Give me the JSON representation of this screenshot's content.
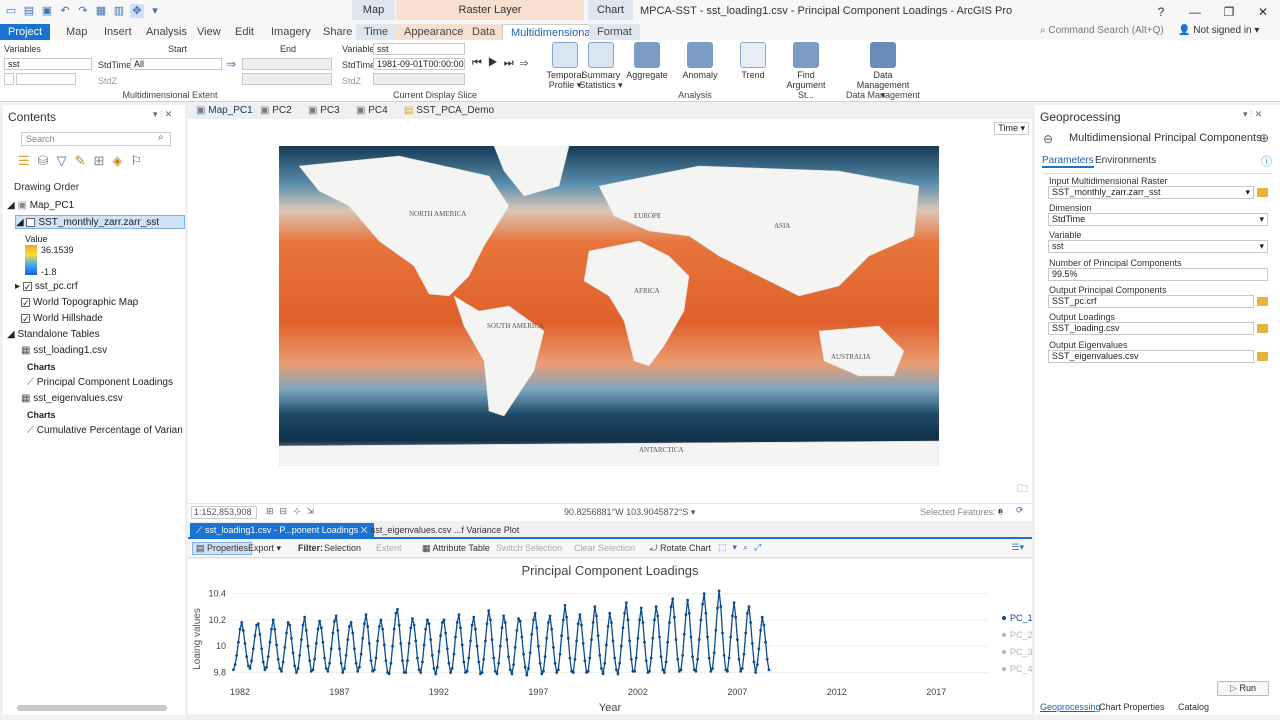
{
  "window": {
    "title": "MPCA-SST - sst_loading1.csv - Principal Component Loadings - ArcGIS Pro",
    "signed_in": "Not signed in",
    "command_search": "Command Search (Alt+Q)"
  },
  "context_headers": {
    "map": "Map",
    "raster_layer": "Raster Layer",
    "chart": "Chart"
  },
  "tabs": [
    "Project",
    "Map",
    "Insert",
    "Analysis",
    "View",
    "Edit",
    "Imagery",
    "Share",
    "Time",
    "Appearance",
    "Data",
    "Multidimensional",
    "Format"
  ],
  "ribbon": {
    "extent": {
      "variables_label": "Variables",
      "variables_value": "sst",
      "start_label": "Start",
      "end_label": "End",
      "stdtime_label": "StdTime",
      "stdtime_value": "All",
      "stdz_label": "StdZ",
      "group_label": "Multidimensional Extent"
    },
    "slice": {
      "variable_label": "Variable",
      "variable_value": "sst",
      "stdtime_label": "StdTime",
      "stdtime_value": "1981-09-01T00:00:00",
      "stdz_label": "StdZ",
      "group_label": "Current Display Slice"
    },
    "analysis": {
      "buttons": [
        "Temporal Profile",
        "Summary Statistics",
        "Aggregate",
        "Anomaly",
        "Trend",
        "Find Argument St..."
      ],
      "group_label": "Analysis"
    },
    "data_mgmt": {
      "button": "Data Management",
      "group_label": "Data Management"
    }
  },
  "contents": {
    "title": "Contents",
    "search_placeholder": "Search",
    "drawing_order": "Drawing Order",
    "map": "Map_PC1",
    "layer": "SST_monthly_zarr.zarr_sst",
    "value_label": "Value",
    "value_high": "36.1539",
    "value_low": "-1.8",
    "layers": [
      "sst_pc.crf",
      "World Topographic Map",
      "World Hillshade"
    ],
    "standalone": "Standalone Tables",
    "table1": "sst_loading1.csv",
    "charts_label": "Charts",
    "chart1": "Principal Component Loadings",
    "table2": "sst_eigenvalues.csv",
    "chart2": "Cumulative Percentage of Variance Plo"
  },
  "views": {
    "tabs": [
      "Map_PC1",
      "PC2",
      "PC3",
      "PC4",
      "SST_PCA_Demo"
    ],
    "time_label": "Time"
  },
  "map": {
    "labels": {
      "north_america": "NORTH AMERICA",
      "europe": "EUROPE",
      "asia": "ASIA",
      "africa": "AFRICA",
      "south_america": "SOUTH AMERICA",
      "australia": "AUSTRALIA",
      "antarctica": "ANTARCTICA"
    },
    "scale": "1:152,853,908",
    "coords": "90.8256881°W 103.9045872°S",
    "selected_features": "Selected Features: 0"
  },
  "chart_tabs": [
    "sst_loading1.csv - P...ponent Loadings",
    "sst_eigenvalues.csv ...f Variance Plot"
  ],
  "chart_toolbar": {
    "properties": "Properties",
    "export": "Export",
    "filter": "Filter:",
    "selection": "Selection",
    "extent": "Extent",
    "attribute_table": "Attribute Table",
    "switch_selection": "Switch Selection",
    "clear_selection": "Clear Selection",
    "rotate_chart": "Rotate Chart"
  },
  "chart_data": {
    "type": "line",
    "title": "Principal Component Loadings",
    "xlabel": "Year",
    "ylabel": "Loaing values",
    "xlim": [
      1981.7,
      2019.6
    ],
    "ylim": [
      9.72,
      10.45
    ],
    "x_ticks": [
      "1982",
      "1987",
      "1992",
      "1997",
      "2002",
      "2007",
      "2012",
      "2017"
    ],
    "y_ticks": [
      "9.8",
      "10",
      "10.2",
      "10.4"
    ],
    "legend_position": "right",
    "colors": {
      "pc1": "#0b4d8c",
      "inactive": "#aab7c6"
    },
    "series": [
      {
        "name": "PC_1",
        "start_year": 1981.67,
        "step_years": 0.08333,
        "values": [
          9.82,
          9.86,
          9.93,
          10.03,
          10.13,
          10.18,
          10.12,
          10.02,
          9.92,
          9.85,
          9.83,
          9.89,
          9.98,
          10.08,
          10.16,
          10.17,
          10.09,
          9.98,
          9.88,
          9.82,
          9.84,
          9.92,
          10.03,
          10.13,
          10.2,
          10.13,
          10.01,
          9.9,
          9.83,
          9.81,
          9.88,
          9.99,
          10.1,
          10.18,
          10.16,
          10.06,
          9.95,
          9.85,
          9.8,
          9.83,
          9.93,
          10.05,
          10.16,
          10.22,
          10.12,
          10.0,
          9.89,
          9.81,
          9.82,
          9.9,
          10.02,
          10.13,
          10.19,
          10.14,
          10.03,
          9.91,
          9.83,
          9.81,
          9.87,
          9.98,
          10.1,
          10.19,
          10.23,
          10.12,
          9.98,
          9.87,
          9.8,
          9.83,
          9.93,
          10.05,
          10.15,
          10.18,
          10.1,
          9.98,
          9.87,
          9.81,
          9.84,
          9.94,
          10.06,
          10.17,
          10.24,
          10.15,
          10.02,
          9.89,
          9.81,
          9.82,
          9.91,
          10.04,
          10.15,
          10.2,
          10.13,
          10.01,
          9.89,
          9.8,
          9.79,
          9.87,
          10.0,
          10.13,
          10.25,
          10.28,
          10.16,
          10.02,
          9.89,
          9.8,
          9.8,
          9.89,
          10.02,
          10.14,
          10.21,
          10.16,
          10.04,
          9.91,
          9.82,
          9.8,
          9.88,
          10.01,
          10.13,
          10.2,
          10.17,
          10.05,
          9.93,
          9.83,
          9.79,
          9.84,
          9.96,
          10.08,
          10.18,
          10.2,
          10.1,
          9.98,
          9.87,
          9.8,
          9.83,
          9.94,
          10.07,
          10.18,
          10.24,
          10.14,
          10.01,
          9.88,
          9.8,
          9.81,
          9.91,
          10.04,
          10.16,
          10.22,
          10.13,
          10.0,
          9.88,
          9.79,
          9.8,
          9.9,
          10.04,
          10.17,
          10.27,
          10.2,
          10.05,
          9.91,
          9.81,
          9.79,
          9.87,
          10.0,
          10.14,
          10.23,
          10.18,
          10.05,
          9.92,
          9.82,
          9.79,
          9.86,
          9.99,
          10.12,
          10.21,
          10.19,
          10.07,
          9.94,
          9.84,
          9.78,
          9.83,
          9.95,
          10.09,
          10.2,
          10.25,
          10.14,
          10.0,
          9.87,
          9.79,
          9.81,
          9.92,
          10.06,
          10.18,
          10.23,
          10.13,
          9.99,
          9.87,
          9.8,
          9.82,
          9.94,
          10.08,
          10.2,
          10.31,
          10.22,
          10.06,
          9.91,
          9.81,
          9.8,
          9.9,
          10.04,
          10.17,
          10.24,
          10.16,
          10.02,
          9.89,
          9.8,
          9.81,
          9.91,
          10.05,
          10.18,
          10.3,
          10.23,
          10.08,
          9.93,
          9.83,
          9.79,
          9.87,
          10.01,
          10.15,
          10.25,
          10.18,
          10.04,
          9.91,
          9.82,
          9.79,
          9.87,
          10.0,
          10.14,
          10.25,
          10.33,
          10.2,
          10.04,
          9.9,
          9.81,
          9.81,
          9.91,
          10.06,
          10.2,
          10.29,
          10.18,
          10.03,
          9.89,
          9.8,
          9.81,
          9.91,
          10.06,
          10.2,
          10.3,
          10.23,
          10.07,
          9.92,
          9.82,
          9.8,
          9.88,
          10.03,
          10.18,
          10.3,
          10.36,
          10.22,
          10.05,
          9.9,
          9.81,
          9.82,
          9.93,
          10.09,
          10.24,
          10.35,
          10.25,
          10.07,
          9.92,
          9.82,
          9.81,
          9.9,
          10.05,
          10.2,
          10.32,
          10.4,
          10.25,
          10.07,
          9.91,
          9.81,
          9.83,
          9.95,
          10.12,
          10.29,
          10.42,
          10.3,
          10.1,
          9.93,
          9.82,
          9.81,
          9.91,
          10.07,
          10.23,
          10.33,
          10.22,
          10.05,
          9.9,
          9.81,
          9.83,
          9.94,
          10.1,
          10.25,
          10.3,
          10.18,
          10.02,
          9.88,
          9.8,
          9.86,
          9.98,
          10.12,
          10.22,
          10.16,
          10.03,
          9.9,
          9.82
        ]
      }
    ],
    "legend": [
      "PC_1",
      "PC_2",
      "PC_3",
      "PC_4"
    ]
  },
  "geoprocessing": {
    "title": "Geoprocessing",
    "tool": "Multidimensional Principal Components",
    "tab_params": "Parameters",
    "tab_env": "Environments",
    "fields": [
      {
        "label": "Input Multidimensional Raster",
        "value": "SST_monthly_zarr.zarr_sst"
      },
      {
        "label": "Dimension",
        "value": "StdTime"
      },
      {
        "label": "Variable",
        "value": "sst"
      },
      {
        "label": "Number of Principal Components",
        "value": "99.5%"
      },
      {
        "label": "Output Principal Components",
        "value": "SST_pc.crf"
      },
      {
        "label": "Output Loadings",
        "value": "SST_loading.csv"
      },
      {
        "label": "Output Eigenvalues",
        "value": "SST_eigenvalues.csv"
      }
    ],
    "run": "Run",
    "bottom_tabs": [
      "Geoprocessing",
      "Chart Properties",
      "Catalog"
    ]
  }
}
